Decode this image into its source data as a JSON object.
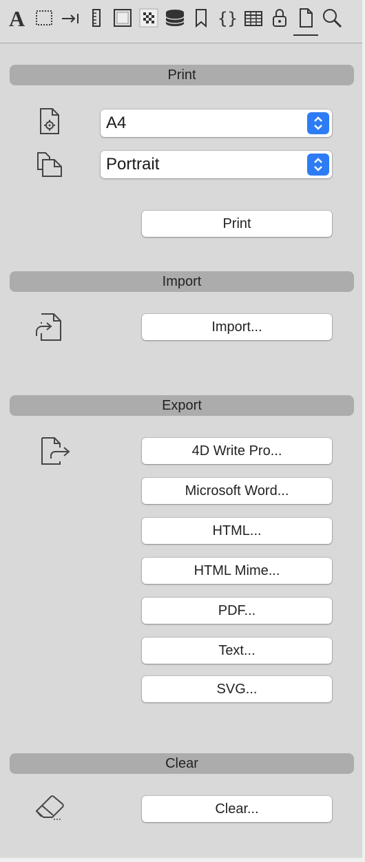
{
  "toolbar": {
    "icons": [
      "font-icon",
      "frame-icon",
      "tab-icon",
      "ruler-icon",
      "background-icon",
      "checker-icon",
      "database-icon",
      "bookmark-icon",
      "braces-icon",
      "table-icon",
      "lock-icon",
      "document-icon",
      "search-icon"
    ],
    "active": "document-icon"
  },
  "print": {
    "header": "Print",
    "paper_size": "A4",
    "orientation": "Portrait",
    "button": "Print"
  },
  "import": {
    "header": "Import",
    "button": "Import..."
  },
  "export": {
    "header": "Export",
    "buttons": [
      "4D Write Pro...",
      "Microsoft Word...",
      "HTML...",
      "HTML Mime...",
      "PDF...",
      "Text...",
      "SVG..."
    ]
  },
  "clear": {
    "header": "Clear",
    "button": "Clear..."
  },
  "colors": {
    "panel": "#d9d9d9",
    "section_bar": "#acacac",
    "accent": "#2d7cf5"
  }
}
